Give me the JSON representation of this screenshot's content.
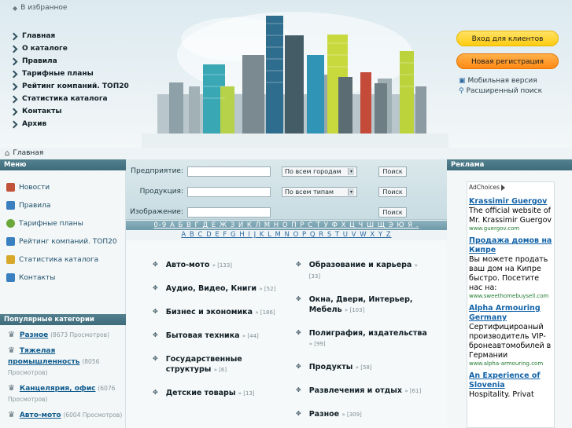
{
  "header": {
    "favorite_label": "В избранное",
    "nav": [
      "Главная",
      "О каталоге",
      "Правила",
      "Тарифные планы",
      "Рейтинг компаний. ТОП20",
      "Статистика каталога",
      "Контакты",
      "Архив"
    ],
    "login_button": "Вход для клиентов",
    "register_button": "Новая регистрация",
    "mobile_link": "Мобильная версия",
    "advanced_search_link": "Расширенный поиск"
  },
  "breadcrumb": "Главная",
  "sidebar": {
    "menu_title": "Меню",
    "menu": [
      {
        "label": "Новости",
        "color": "#c0533a"
      },
      {
        "label": "Правила",
        "color": "#3a7fc0"
      },
      {
        "label": "Тарифные планы",
        "color": "#6aa83a"
      },
      {
        "label": "Рейтинг компаний. ТОП20",
        "color": "#3a7fc0"
      },
      {
        "label": "Статистика каталога",
        "color": "#d7a82a"
      },
      {
        "label": "Контакты",
        "color": "#3a7fc0"
      }
    ],
    "popular_title": "Популярные категории",
    "popular": [
      {
        "name": "Разное",
        "count": "(8673 Просмотров)"
      },
      {
        "name": "Тяжелая промышленность",
        "count": "(8056 Просмотров)"
      },
      {
        "name": "Канцелярия, офис",
        "count": "(6076 Просмотров)"
      },
      {
        "name": "Авто-мото",
        "count": "(6004 Просмотров)"
      }
    ]
  },
  "search": {
    "rows": [
      {
        "label": "Предприятие:",
        "select": "По всем городам",
        "button": "Поиск"
      },
      {
        "label": "Продукция:",
        "select": "По всем типам",
        "button": "Поиск"
      },
      {
        "label": "Изображение:",
        "button": "Поиск"
      }
    ]
  },
  "alphabet": {
    "cyrillic": "0-9 А Б В Г Д Е Ж З И К Л М Н О П Р С Т У Ф Х Ц Ч Ш Щ Э Ю Я .",
    "latin": "A B C D E F G H I J K L M N O P Q R S T U V W X Y Z"
  },
  "categories": {
    "left": [
      {
        "name": "Авто-мото",
        "count": "» [133]"
      },
      {
        "name": "Аудио, Видео, Книги",
        "count": "» [52]"
      },
      {
        "name": "Бизнес и экономика",
        "count": "» [186]"
      },
      {
        "name": "Бытовая техника",
        "count": "» [44]"
      },
      {
        "name": "Государственные структуры",
        "count": "» [6]"
      },
      {
        "name": "Детские товары",
        "count": "» [13]"
      }
    ],
    "right": [
      {
        "name": "Образование и карьера",
        "count": "» [33]"
      },
      {
        "name": "Окна, Двери, Интерьер, Мебель",
        "count": "» [103]"
      },
      {
        "name": "Полиграфия, издательства",
        "count": "» [99]"
      },
      {
        "name": "Продукты",
        "count": "» [58]"
      },
      {
        "name": "Развлечения и отдых",
        "count": "» [61]"
      },
      {
        "name": "Разное",
        "count": "» [309]"
      }
    ]
  },
  "ads": {
    "title": "Реклама",
    "adchoices": "AdChoices",
    "items": [
      {
        "title": "Krassimir Guergov",
        "desc": "The official website of Mr. Krassimir Guergov",
        "url": "www.guergov.com"
      },
      {
        "title": "Продажа домов на Кипре",
        "desc": "Вы можете продать ваш дом на Кипре быстро. Посетите нас на:",
        "url": "www.sweethomebuysell.com"
      },
      {
        "title": "Alpha Armouring Germany",
        "desc": "Сертифицироаный производитель VIP-бронеавтомобилей в Германии",
        "url": "www.alpha-armouring.com"
      },
      {
        "title": "An Experience of Slovenia",
        "desc": "Hospitality. Privat",
        "url": ""
      }
    ]
  }
}
